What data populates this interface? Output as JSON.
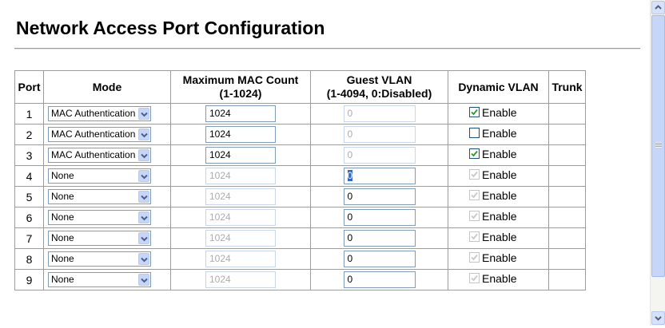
{
  "page_title": "Network Access Port Configuration",
  "table": {
    "headers": {
      "port": "Port",
      "mode": "Mode",
      "max_mac_line1": "Maximum MAC Count",
      "max_mac_line2": "(1-1024)",
      "guest_vlan_line1": "Guest VLAN",
      "guest_vlan_line2": "(1-4094, 0:Disabled)",
      "dynamic_vlan": "Dynamic VLAN",
      "trunk": "Trunk"
    },
    "rows": [
      {
        "port": "1",
        "mode": "MAC Authentication",
        "max_mac": "1024",
        "max_mac_enabled": true,
        "guest_vlan": "0",
        "guest_enabled": false,
        "dynamic_checked": true,
        "dynamic_enabled": true,
        "dynamic_label": "Enable",
        "trunk": ""
      },
      {
        "port": "2",
        "mode": "MAC Authentication",
        "max_mac": "1024",
        "max_mac_enabled": true,
        "guest_vlan": "0",
        "guest_enabled": false,
        "dynamic_checked": false,
        "dynamic_enabled": true,
        "dynamic_label": "Enable",
        "trunk": ""
      },
      {
        "port": "3",
        "mode": "MAC Authentication",
        "max_mac": "1024",
        "max_mac_enabled": true,
        "guest_vlan": "0",
        "guest_enabled": false,
        "dynamic_checked": true,
        "dynamic_enabled": true,
        "dynamic_label": "Enable",
        "trunk": ""
      },
      {
        "port": "4",
        "mode": "None",
        "max_mac": "1024",
        "max_mac_enabled": false,
        "guest_vlan": "0",
        "guest_enabled": true,
        "guest_selected": true,
        "dynamic_checked": true,
        "dynamic_enabled": false,
        "dynamic_label": "Enable",
        "trunk": ""
      },
      {
        "port": "5",
        "mode": "None",
        "max_mac": "1024",
        "max_mac_enabled": false,
        "guest_vlan": "0",
        "guest_enabled": true,
        "dynamic_checked": true,
        "dynamic_enabled": false,
        "dynamic_label": "Enable",
        "trunk": ""
      },
      {
        "port": "6",
        "mode": "None",
        "max_mac": "1024",
        "max_mac_enabled": false,
        "guest_vlan": "0",
        "guest_enabled": true,
        "dynamic_checked": true,
        "dynamic_enabled": false,
        "dynamic_label": "Enable",
        "trunk": ""
      },
      {
        "port": "7",
        "mode": "None",
        "max_mac": "1024",
        "max_mac_enabled": false,
        "guest_vlan": "0",
        "guest_enabled": true,
        "dynamic_checked": true,
        "dynamic_enabled": false,
        "dynamic_label": "Enable",
        "trunk": ""
      },
      {
        "port": "8",
        "mode": "None",
        "max_mac": "1024",
        "max_mac_enabled": false,
        "guest_vlan": "0",
        "guest_enabled": true,
        "dynamic_checked": true,
        "dynamic_enabled": false,
        "dynamic_label": "Enable",
        "trunk": ""
      },
      {
        "port": "9",
        "mode": "None",
        "max_mac": "1024",
        "max_mac_enabled": false,
        "guest_vlan": "0",
        "guest_enabled": true,
        "dynamic_checked": true,
        "dynamic_enabled": false,
        "dynamic_label": "Enable",
        "trunk": ""
      }
    ]
  },
  "icons": {
    "dropdown": "chevron-down-icon",
    "checkbox": "checkmark-icon",
    "scroll_up": "scroll-up-arrow-icon",
    "scroll_down": "scroll-down-arrow-icon"
  },
  "colors": {
    "input_border": "#7f9db9",
    "dropdown_button": "#c5d5fb",
    "selection_highlight": "#316ac5",
    "disabled_text": "#acacac"
  }
}
